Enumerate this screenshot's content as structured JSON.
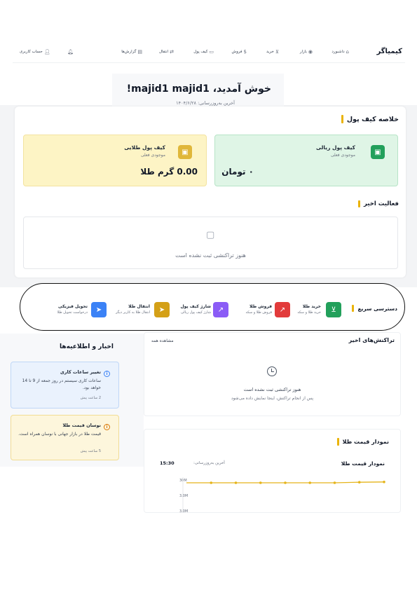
{
  "nav": {
    "brand": "کیمیاگر",
    "items": [
      {
        "label": "داشبورد",
        "icon": "home-icon"
      },
      {
        "label": "بازار",
        "icon": "eye-icon"
      },
      {
        "label": "خرید",
        "icon": "cart-icon"
      },
      {
        "label": "فروش",
        "icon": "dollar-icon"
      },
      {
        "label": "کیف پول",
        "icon": "wallet-icon"
      },
      {
        "label": "انتقال",
        "icon": "transfer-icon"
      },
      {
        "label": "گزارش‌ها",
        "icon": "report-icon"
      }
    ],
    "bell_icon": "bell-icon",
    "account_label": "حساب کاربری"
  },
  "welcome": {
    "title": "خوش آمدید، majid1 majid1!",
    "last_update": "آخرین به‌روزرسانی: ۱۴۰۴/۶/۲۸"
  },
  "wallet_summary": {
    "title": "خلاصه کیف پول",
    "rial": {
      "title": "کیف پول ریالی",
      "subtitle": "موجودی فعلی",
      "value": "۰ تومان"
    },
    "gold": {
      "title": "کیف پول طلایی",
      "subtitle": "موجودی فعلی",
      "value": "0.00 گرم طلا"
    },
    "recent_title": "فعالیت اخیر",
    "empty_text": "هنوز تراکنشی ثبت نشده است"
  },
  "quick_access": {
    "title": "دسترسی سریع",
    "items": [
      {
        "title": "خرید طلا",
        "subtitle": "خرید طلا و سکه",
        "color": "#22a05b"
      },
      {
        "title": "فروش طلا",
        "subtitle": "فروش طلا و سکه",
        "color": "#e23b3b"
      },
      {
        "title": "شارژ کیف پول",
        "subtitle": "شارژ کیف پول ریالی",
        "color": "#8b5cf6"
      },
      {
        "title": "انتقال طلا",
        "subtitle": "انتقال طلا به کاربر دیگر",
        "color": "#d4a017"
      },
      {
        "title": "تحویل فیزیکی",
        "subtitle": "درخواست تحویل طلا",
        "color": "#3b82f6"
      }
    ]
  },
  "transactions": {
    "title": "تراکنش‌های اخیر",
    "view_all": "مشاهده همه",
    "empty_title": "هنوز تراکنشی ثبت نشده است",
    "empty_sub": "پس از انجام تراکنش، اینجا نمایش داده می‌شود"
  },
  "news": {
    "title": "اخبار و اطلاعیه‌ها",
    "items": [
      {
        "title": "تغییر ساعات کاری",
        "body": "ساعات کاری سیستم در روز جمعه از 9 تا 14 خواهد بود.",
        "time": "2 ساعت پیش"
      },
      {
        "title": "نوسان قیمت طلا",
        "body": "قیمت طلا در بازار جهانی با نوسان همراه است.",
        "time": "5 ساعت پیش"
      }
    ]
  },
  "price_chart": {
    "section_title": "نمودار قیمت طلا",
    "title": "نمودار قیمت طلا",
    "updated_label": "آخرین به‌روزرسانی:",
    "time": "15:30"
  },
  "chart_data": {
    "type": "line",
    "title": "نمودار قیمت طلا",
    "y_tick_labels": [
      "30M",
      "3.0M",
      "3.0M"
    ],
    "values": [
      30,
      30,
      30,
      30,
      30,
      30,
      30,
      30.2,
      30.3
    ],
    "color": "#e5b41a"
  }
}
